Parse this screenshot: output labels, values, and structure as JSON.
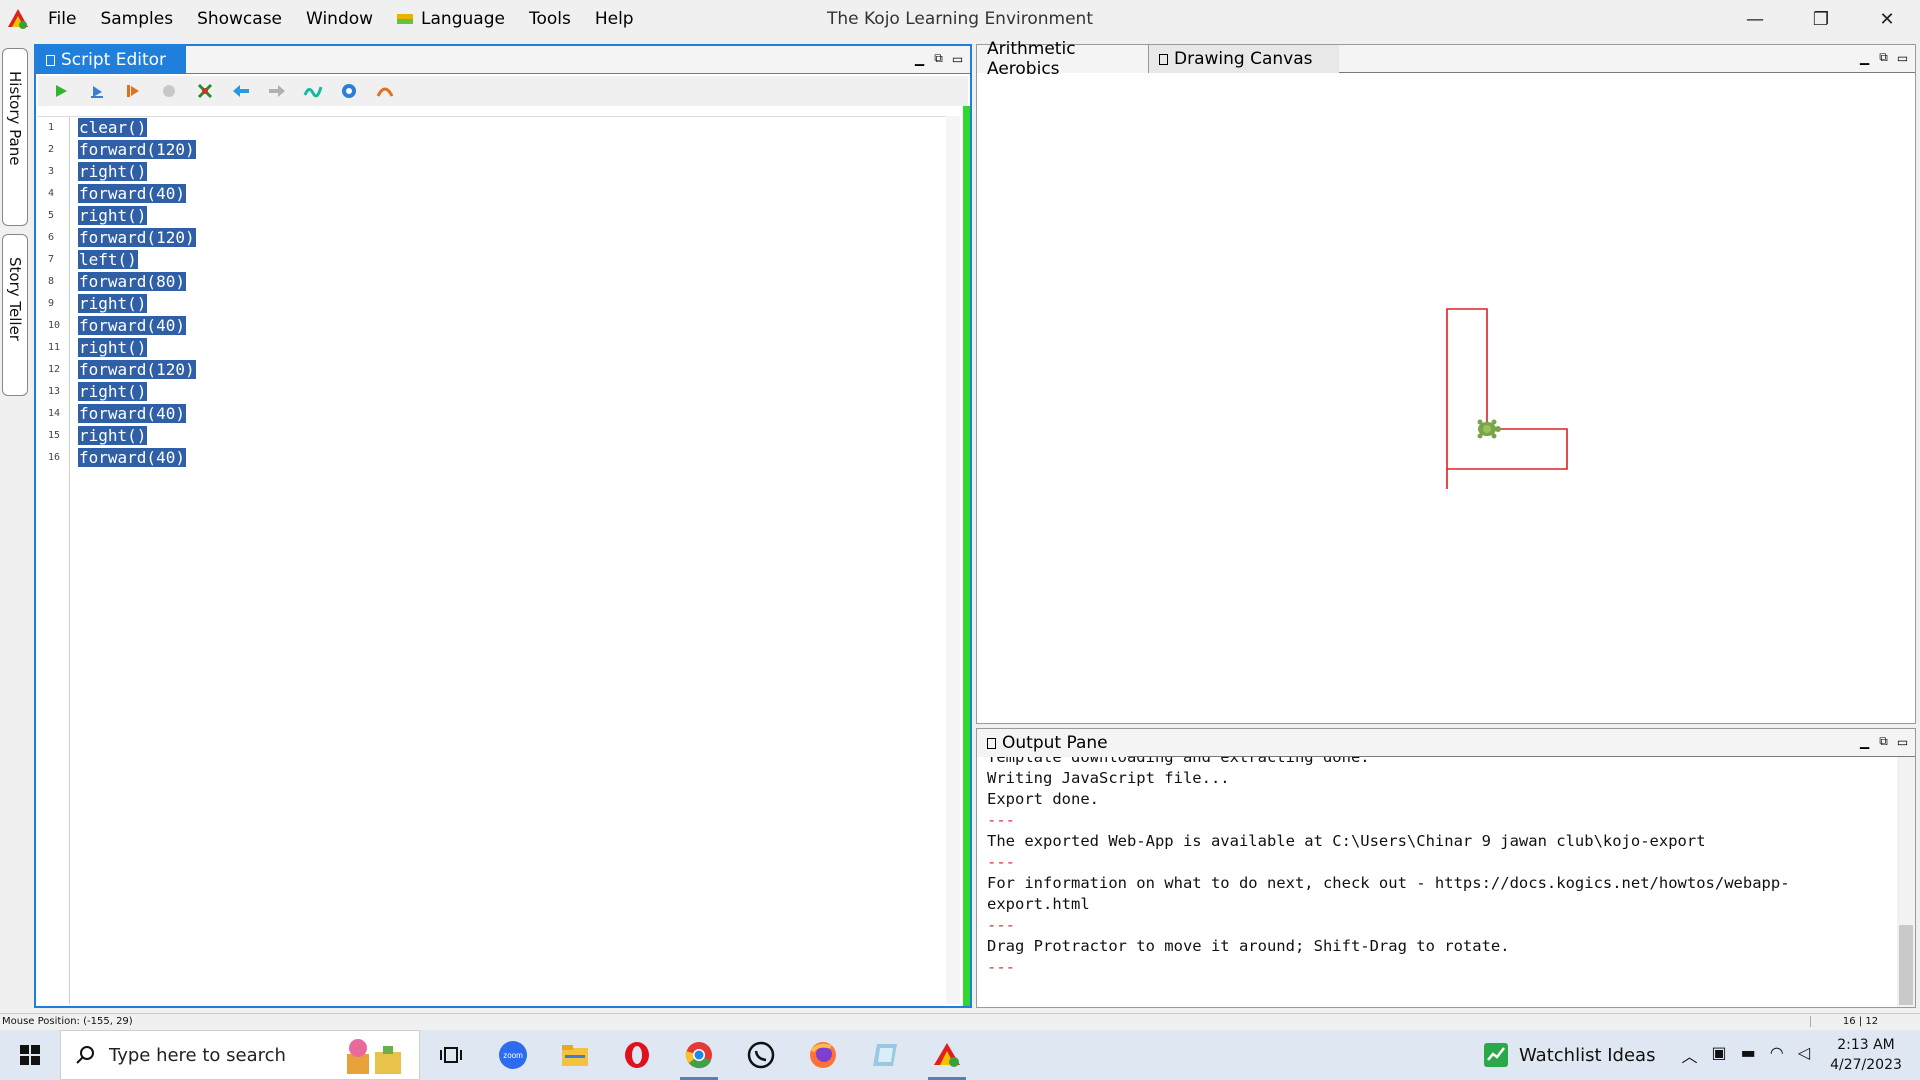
{
  "window": {
    "title": "The Kojo Learning Environment",
    "minimize": "—",
    "restore": "❐",
    "close": "✕"
  },
  "menu": [
    "File",
    "Samples",
    "Showcase",
    "Window",
    "Language",
    "Tools",
    "Help"
  ],
  "side_tabs": [
    "History Pane",
    "Story Teller"
  ],
  "script_editor": {
    "tab_label": "Script Editor",
    "toolbar_icons": [
      "run-icon",
      "run-worksheet-icon",
      "trace-icon",
      "stop-icon",
      "clear-icon",
      "undo-icon",
      "redo-icon",
      "format-icon",
      "help-icon",
      "kojo-icon"
    ],
    "line_numbers": [
      "1",
      "2",
      "3",
      "4",
      "5",
      "6",
      "7",
      "8",
      "9",
      "10",
      "11",
      "12",
      "13",
      "14",
      "15",
      "16"
    ],
    "lines": [
      "clear()",
      "forward(120)",
      "right()",
      "forward(40)",
      "right()",
      "forward(120)",
      "left()",
      "forward(80)",
      "right()",
      "forward(40)",
      "right()",
      "forward(120)",
      "right()",
      "forward(40)",
      "right()",
      "forward(40)"
    ]
  },
  "canvas_tabs": {
    "tab1": "Arithmetic Aerobics",
    "tab2": "Drawing Canvas"
  },
  "output_pane": {
    "tab_label": "Output Pane",
    "lines": [
      {
        "text": "Template downloading and extracting done.",
        "sep": false
      },
      {
        "text": "Writing JavaScript file...",
        "sep": false
      },
      {
        "text": "Export done.",
        "sep": false
      },
      {
        "text": "---",
        "sep": true
      },
      {
        "text": "The exported Web-App is available at C:\\Users\\Chinar 9 jawan club\\kojo-export",
        "sep": false
      },
      {
        "text": "---",
        "sep": true
      },
      {
        "text": "For information on what to do next, check out - https://docs.kogics.net/howtos/webapp-",
        "sep": false
      },
      {
        "text": "export.html",
        "sep": false
      },
      {
        "text": "---",
        "sep": true
      },
      {
        "text": "Drag Protractor to move it around; Shift-Drag to rotate.",
        "sep": false
      },
      {
        "text": "---",
        "sep": true
      }
    ]
  },
  "status": {
    "mouse_position": "Mouse Position: (-155, 29)",
    "caret": "16 | 12"
  },
  "taskbar": {
    "search_placeholder": "Type here to search",
    "apps": [
      "task-view-icon",
      "zoom-icon",
      "file-explorer-icon",
      "opera-icon",
      "chrome-icon",
      "whatsapp-icon",
      "firefox-icon",
      "notepad-icon",
      "kojo-icon"
    ],
    "zoom_label": "zoom",
    "widget_label": "Watchlist Ideas",
    "time": "2:13 AM",
    "date": "4/27/2023"
  },
  "colors": {
    "accent_blue": "#1f7fdb",
    "selection": "#2f5fa7",
    "drawing_red": "#e0201e",
    "separator_green": "#2ed82e"
  }
}
